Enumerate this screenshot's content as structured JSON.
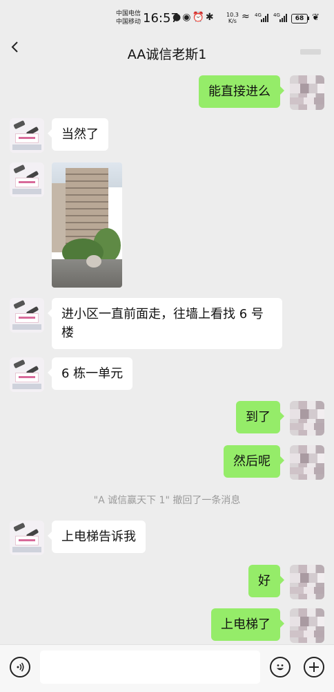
{
  "status_bar": {
    "carrier_1": "中国电信",
    "carrier_2": "中国移动",
    "time": "16:57",
    "net_speed_value": "10.3",
    "net_speed_unit": "K/s",
    "signal_tag_1": "4G",
    "signal_tag_2": "4G",
    "battery": "68",
    "icons": [
      "message-icon",
      "eye-icon",
      "alarm-icon",
      "bluetooth-icon",
      "wifi-icon",
      "signal-icon",
      "battery-icon",
      "leaf-icon"
    ]
  },
  "header": {
    "title": "AA诚信老斯1",
    "back_icon": "chevron-left-icon"
  },
  "messages": [
    {
      "side": "right",
      "text": "能直接进么"
    },
    {
      "side": "left",
      "text": "当然了"
    },
    {
      "side": "left",
      "type": "image"
    },
    {
      "side": "left",
      "text": "进小区一直前面走，往墙上看找 6 号楼"
    },
    {
      "side": "left",
      "text": "6 栋一单元"
    },
    {
      "side": "right",
      "text": "到了"
    },
    {
      "side": "right",
      "text": "然后呢"
    },
    {
      "side": "left",
      "text": "上电梯告诉我"
    },
    {
      "side": "right",
      "text": "好"
    },
    {
      "side": "right",
      "text": "上电梯了"
    }
  ],
  "system_message": "\"A 诚信赢天下 1\" 撤回了一条消息",
  "input_bar": {
    "placeholder": "",
    "icons": [
      "voice-icon",
      "emoji-icon",
      "plus-icon"
    ]
  },
  "colors": {
    "background": "#ededed",
    "bubble_self": "#95ec69",
    "bubble_other": "#ffffff"
  }
}
